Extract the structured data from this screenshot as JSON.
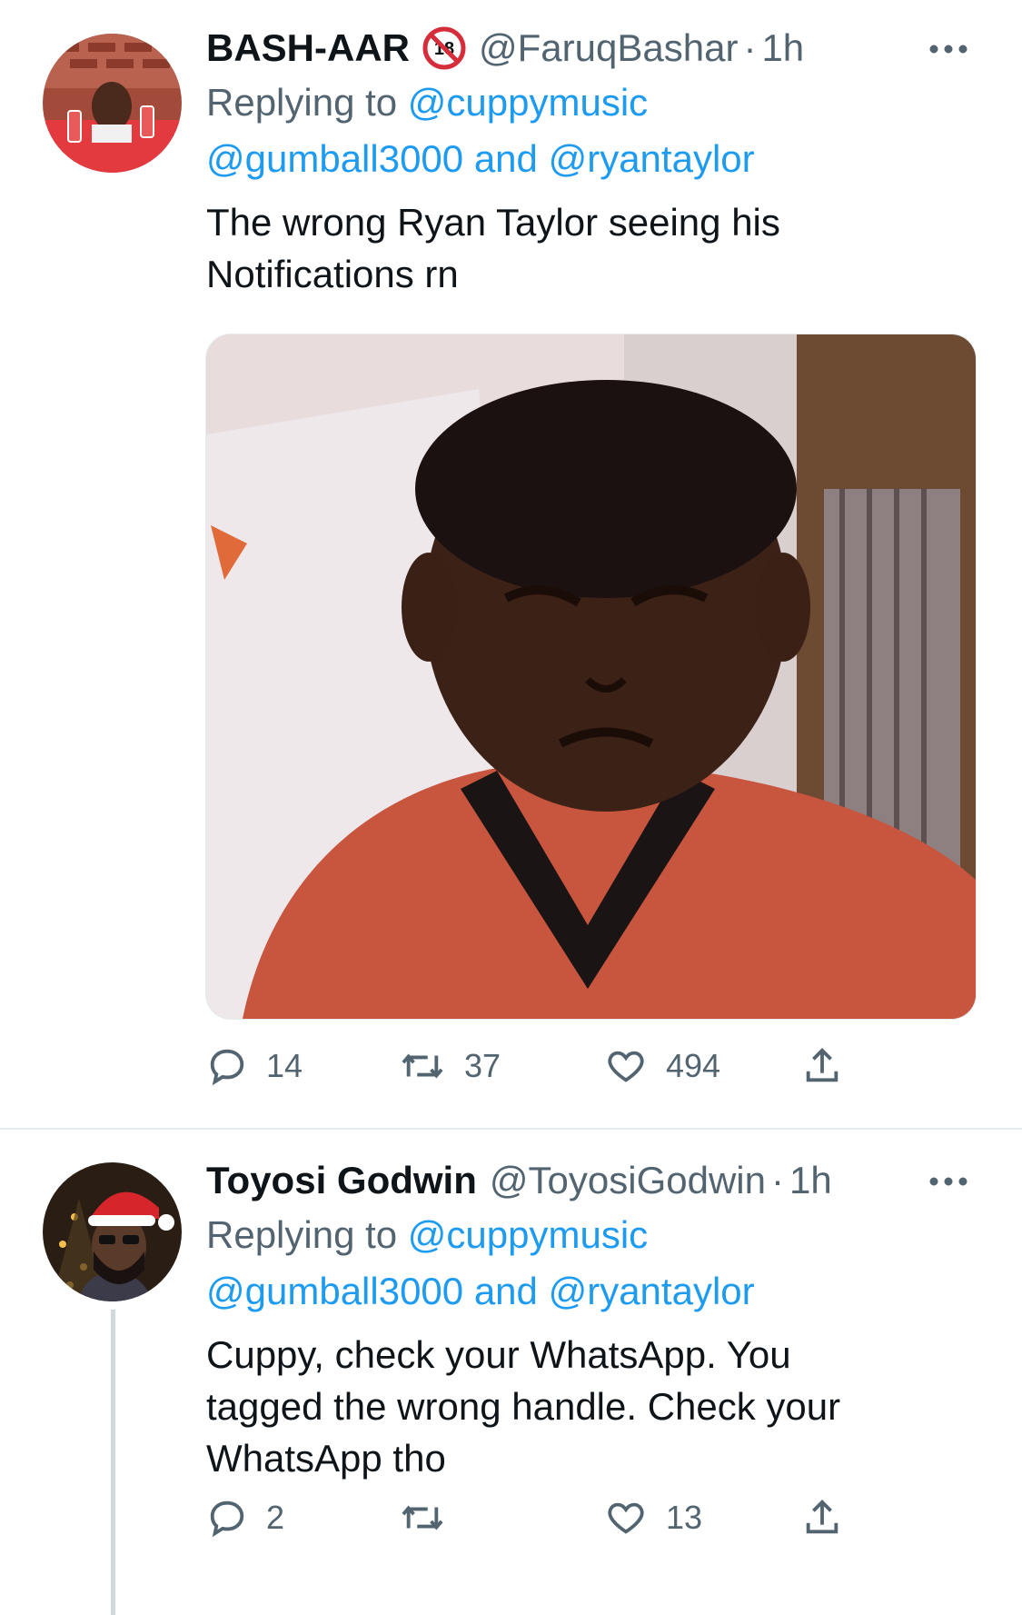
{
  "colors": {
    "accent": "#1d9bf0",
    "secondary_text": "#536471",
    "primary_text": "#0f1419"
  },
  "tweets": [
    {
      "display_name": "BASH-AAR",
      "badge_icon": "18-plus-badge-icon",
      "handle": "@FaruqBashar",
      "separator": "·",
      "time": "1h",
      "replying_prefix": "Replying to",
      "mention_1": "@cuppymusic",
      "mention_2": "@gumball3000",
      "and_word": "and",
      "mention_3": "@ryantaylor",
      "text_line_1": "The wrong Ryan Taylor seeing his",
      "text_line_2": "Notifications rn",
      "media_icon": "photo-meme-icon",
      "replies": "14",
      "retweets": "37",
      "likes": "494"
    },
    {
      "display_name": "Toyosi Godwin",
      "handle": "@ToyosiGodwin",
      "separator": "·",
      "time": "1h",
      "replying_prefix": "Replying to",
      "mention_1": "@cuppymusic",
      "mention_2": "@gumball3000",
      "and_word": "and",
      "mention_3": "@ryantaylor",
      "text_line_1": "Cuppy, check your WhatsApp. You",
      "text_line_2": "tagged the wrong handle. Check your",
      "text_line_3": "WhatsApp tho",
      "replies": "2",
      "retweets": "",
      "likes": "13"
    }
  ]
}
